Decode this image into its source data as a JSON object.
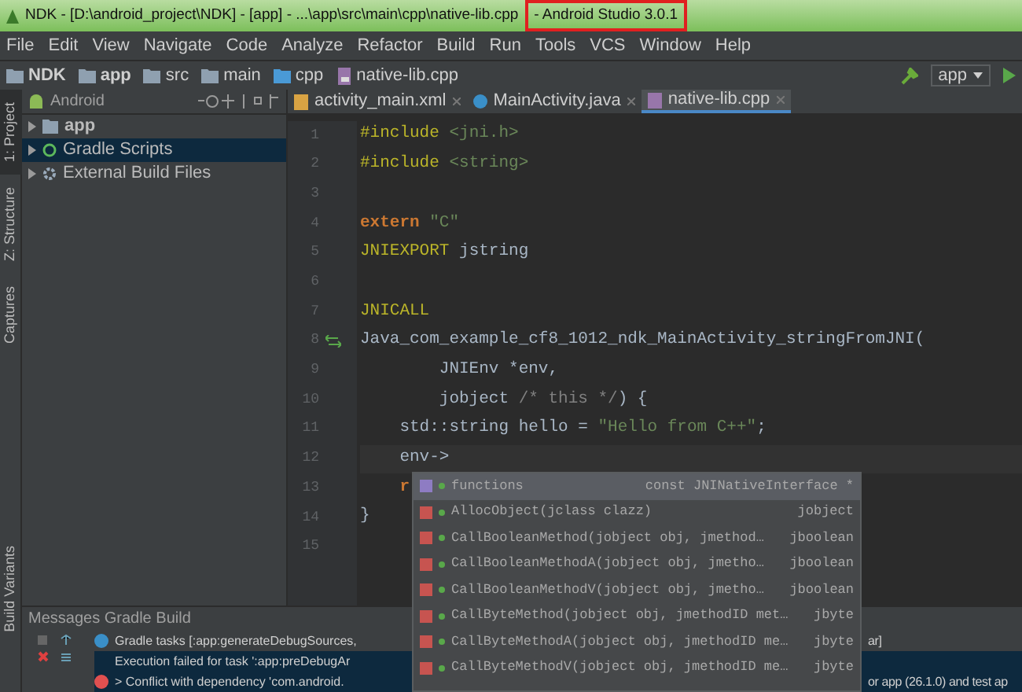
{
  "window": {
    "title": "NDK - [D:\\android_project\\NDK] - [app] - ...\\app\\src\\main\\cpp\\native-lib.cpp",
    "highlighted": "- Android Studio 3.0.1"
  },
  "menu": [
    "File",
    "Edit",
    "View",
    "Navigate",
    "Code",
    "Analyze",
    "Refactor",
    "Build",
    "Run",
    "Tools",
    "VCS",
    "Window",
    "Help"
  ],
  "breadcrumbs": [
    {
      "label": "NDK",
      "kind": "project"
    },
    {
      "label": "app",
      "kind": "module"
    },
    {
      "label": "src",
      "kind": "folder"
    },
    {
      "label": "main",
      "kind": "folder"
    },
    {
      "label": "cpp",
      "kind": "source"
    },
    {
      "label": "native-lib.cpp",
      "kind": "file"
    }
  ],
  "run_config": "app",
  "side_tabs": [
    {
      "label": "1: Project",
      "selected": true
    },
    {
      "label": "Z: Structure",
      "selected": false
    },
    {
      "label": "Captures",
      "selected": false
    }
  ],
  "bottom_side_tab": "Build Variants",
  "project": {
    "view": "Android",
    "items": [
      {
        "label": "app",
        "kind": "module",
        "selected": false
      },
      {
        "label": "Gradle Scripts",
        "kind": "gradle",
        "selected": true
      },
      {
        "label": "External Build Files",
        "kind": "external",
        "selected": false
      }
    ]
  },
  "editor_tabs": [
    {
      "label": "activity_main.xml",
      "kind": "xml",
      "selected": false
    },
    {
      "label": "MainActivity.java",
      "kind": "java",
      "selected": false
    },
    {
      "label": "native-lib.cpp",
      "kind": "cpp",
      "selected": true
    }
  ],
  "code_lines": [
    {
      "number": "1",
      "tokens": [
        {
          "kind": "directive",
          "text": "#include"
        },
        {
          "kind": "header",
          "text": " <jni.h>"
        }
      ]
    },
    {
      "number": "2",
      "tokens": [
        {
          "kind": "directive",
          "text": "#include"
        },
        {
          "kind": "header",
          "text": " <string>"
        }
      ]
    },
    {
      "number": "3"
    },
    {
      "number": "4",
      "tokens": [
        {
          "kind": "keyword",
          "text": "extern"
        },
        {
          "kind": "string",
          "text": " \"C\""
        }
      ]
    },
    {
      "number": "5",
      "tokens": [
        {
          "kind": "macro",
          "text": "JNIEXPORT"
        },
        {
          "kind": "plain",
          "text": " jstring"
        }
      ]
    },
    {
      "number": "6"
    },
    {
      "number": "7",
      "tokens": [
        {
          "kind": "macro",
          "text": "JNICALL"
        }
      ]
    },
    {
      "number": "8",
      "gutter_icon": true,
      "tokens": [
        {
          "kind": "plain",
          "text": "Java_com_example_cf8_1012_ndk_MainActivity_stringFromJNI("
        }
      ]
    },
    {
      "number": "9",
      "tokens": [
        {
          "kind": "plain",
          "text": "        JNIEnv *env,"
        }
      ]
    },
    {
      "number": "10",
      "tokens": [
        {
          "kind": "plain",
          "text": "        jobject"
        },
        {
          "kind": "comment",
          "text": " /* this */"
        },
        {
          "kind": "plain",
          "text": ") {"
        }
      ]
    },
    {
      "number": "11",
      "tokens": [
        {
          "kind": "plain",
          "text": "    std::string hello = "
        },
        {
          "kind": "string",
          "text": "\"Hello from C++\""
        },
        {
          "kind": "plain",
          "text": ";"
        }
      ]
    },
    {
      "number": "12",
      "current": true,
      "tokens": [
        {
          "kind": "plain",
          "text": "    env->"
        }
      ]
    },
    {
      "number": "13",
      "tokens": [
        {
          "kind": "keyword",
          "text": "    r"
        }
      ]
    },
    {
      "number": "14",
      "tokens": [
        {
          "kind": "plain",
          "text": "}"
        }
      ]
    },
    {
      "number": "15"
    }
  ],
  "completion": [
    {
      "kind": "field",
      "name": "functions",
      "type": "const JNINativeInterface *",
      "selected": true
    },
    {
      "kind": "method",
      "name": "AllocObject(jclass clazz)",
      "type": "jobject",
      "selected": false
    },
    {
      "kind": "method",
      "name": "CallBooleanMethod(jobject obj, jmethod…",
      "type": "jboolean",
      "selected": false
    },
    {
      "kind": "method",
      "name": "CallBooleanMethodA(jobject obj, jmetho…",
      "type": "jboolean",
      "selected": false
    },
    {
      "kind": "method",
      "name": "CallBooleanMethodV(jobject obj, jmetho…",
      "type": "jboolean",
      "selected": false
    },
    {
      "kind": "method",
      "name": "CallByteMethod(jobject obj, jmethodID met…",
      "type": "jbyte",
      "selected": false
    },
    {
      "kind": "method",
      "name": "CallByteMethodA(jobject obj, jmethodID me…",
      "type": "jbyte",
      "selected": false
    },
    {
      "kind": "method",
      "name": "CallByteMethodV(jobject obj, jmethodID me…",
      "type": "jbyte",
      "selected": false
    }
  ],
  "messages": {
    "title": "Messages Gradle Build",
    "rows": [
      {
        "kind": "info",
        "text": "Gradle tasks [:app:generateDebugSources,",
        "tail": "ar]",
        "selected": false
      },
      {
        "kind": "plain",
        "text": "Execution failed for task ':app:preDebugAr",
        "selected": true
      },
      {
        "kind": "error",
        "text": "> Conflict with dependency 'com.android.",
        "tail": "or app (26.1.0) and test ap",
        "selected": true
      }
    ]
  }
}
